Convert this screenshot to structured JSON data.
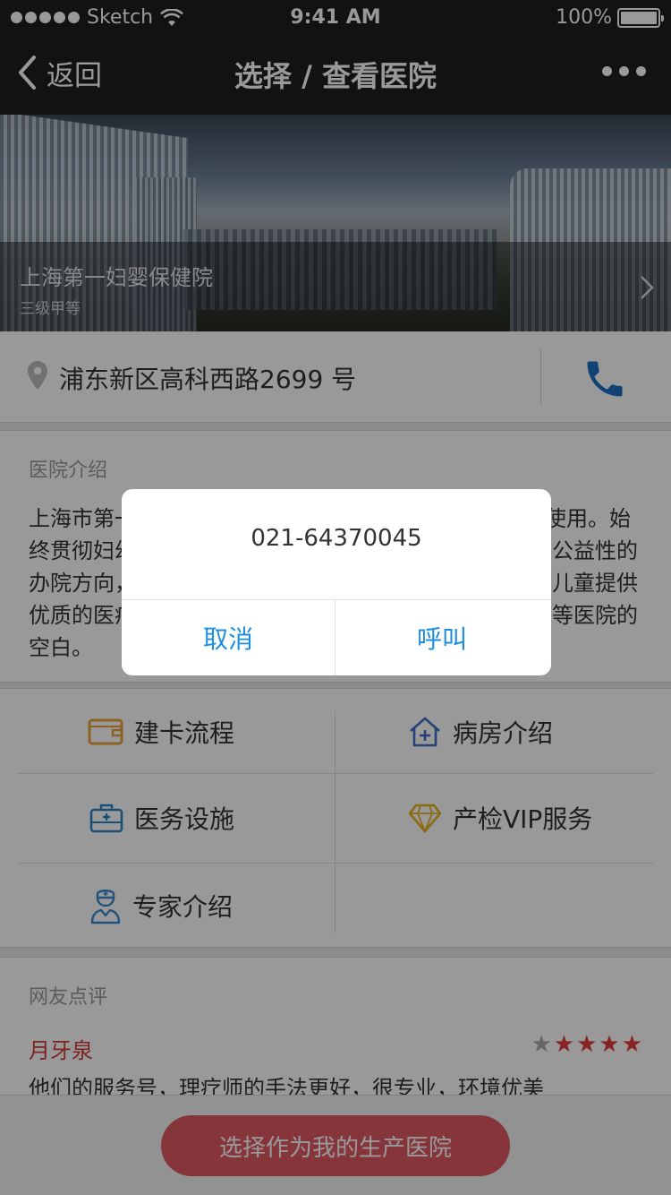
{
  "status_bar": {
    "carrier": "Sketch",
    "time": "9:41 AM",
    "battery": "100%"
  },
  "nav": {
    "back_label": "返回",
    "title": "选择 / 查看医院"
  },
  "hospital": {
    "name": "上海第一妇婴保健院",
    "level": "三级甲等",
    "address": "浦东新区高科西路2699 号"
  },
  "intro": {
    "title": "医院介绍",
    "lines": [
      "上海市第一",
      "使用。始",
      "终贯彻妇幼",
      "公益性的",
      "办院方向，",
      "儿童提供",
      "优质的医疗",
      "等医院的",
      "空白。"
    ]
  },
  "features": [
    {
      "label": "建卡流程",
      "icon": "card-icon",
      "color": "#e8a33b"
    },
    {
      "label": "病房介绍",
      "icon": "home-plus-icon",
      "color": "#3c6ec8"
    },
    {
      "label": "医务设施",
      "icon": "medkit-icon",
      "color": "#2a83c6"
    },
    {
      "label": "产检VIP服务",
      "icon": "diamond-icon",
      "color": "#e8b21f"
    },
    {
      "label": "专家介绍",
      "icon": "nurse-icon",
      "color": "#3b8bd1"
    }
  ],
  "reviews": {
    "title": "网友点评",
    "reviewer": "月牙泉",
    "rating": 4,
    "rating_max": 5,
    "text": "他们的服务号，理疗师的手法更好，很专业，环境优美"
  },
  "bottom": {
    "select_label": "选择作为我的生产医院"
  },
  "dialog": {
    "message": "021-64370045",
    "cancel_label": "取消",
    "call_label": "呼叫"
  },
  "colors": {
    "accent_blue": "#1e8ee0",
    "brand_red": "#e05a63",
    "nav_bg": "#1e1e20"
  }
}
